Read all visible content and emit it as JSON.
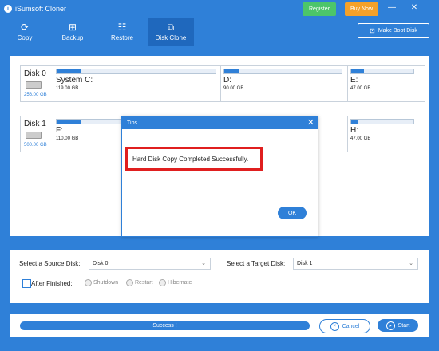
{
  "app": {
    "title": "iSumsoft Cloner",
    "register_label": "Register",
    "buy_label": "Buy Now",
    "minimize_glyph": "—",
    "close_glyph": "✕"
  },
  "nav": {
    "tabs": [
      {
        "label": "Copy",
        "icon": "copy-icon",
        "active": false
      },
      {
        "label": "Backup",
        "icon": "backup-icon",
        "active": false
      },
      {
        "label": "Restore",
        "icon": "restore-icon",
        "active": false
      },
      {
        "label": "Disk Clone",
        "icon": "disk-clone-icon",
        "active": true
      }
    ],
    "boot_disk_label": "Make Boot Disk"
  },
  "disks": [
    {
      "name": "Disk 0",
      "size": "256.00 GB",
      "partitions": [
        {
          "label": "System C:",
          "size": "119.00 GB",
          "used_fraction": 0.15
        },
        {
          "label": "D:",
          "size": "90.00 GB",
          "used_fraction": 0.12
        },
        {
          "label": "E:",
          "size": "47.00 GB",
          "used_fraction": 0.2
        }
      ]
    },
    {
      "name": "Disk 1",
      "size": "500.00 GB",
      "partitions": [
        {
          "label": "F:",
          "size": "110.00 GB",
          "used_fraction": 0.15
        },
        {
          "label": "H:",
          "size": "47.00 GB",
          "used_fraction": 0.1
        }
      ]
    }
  ],
  "options": {
    "source_label": "Select a Source Disk:",
    "source_value": "Disk 0",
    "target_label": "Select a Target Disk:",
    "target_value": "Disk 1",
    "after_finished_label": "After Finished:",
    "after_actions": [
      "Shutdown",
      "Restart",
      "Hibernate"
    ]
  },
  "progress": {
    "status_text": "Success !",
    "percent": 100,
    "cancel_label": "Cancel",
    "start_label": "Start"
  },
  "dialog": {
    "title": "Tips",
    "message": "Hard Disk Copy Completed Successfully.",
    "ok_label": "OK"
  },
  "colors": {
    "accent": "#2f80d8",
    "register": "#4cc56a",
    "buy": "#f4a12a",
    "highlight_border": "#e01f1f"
  }
}
